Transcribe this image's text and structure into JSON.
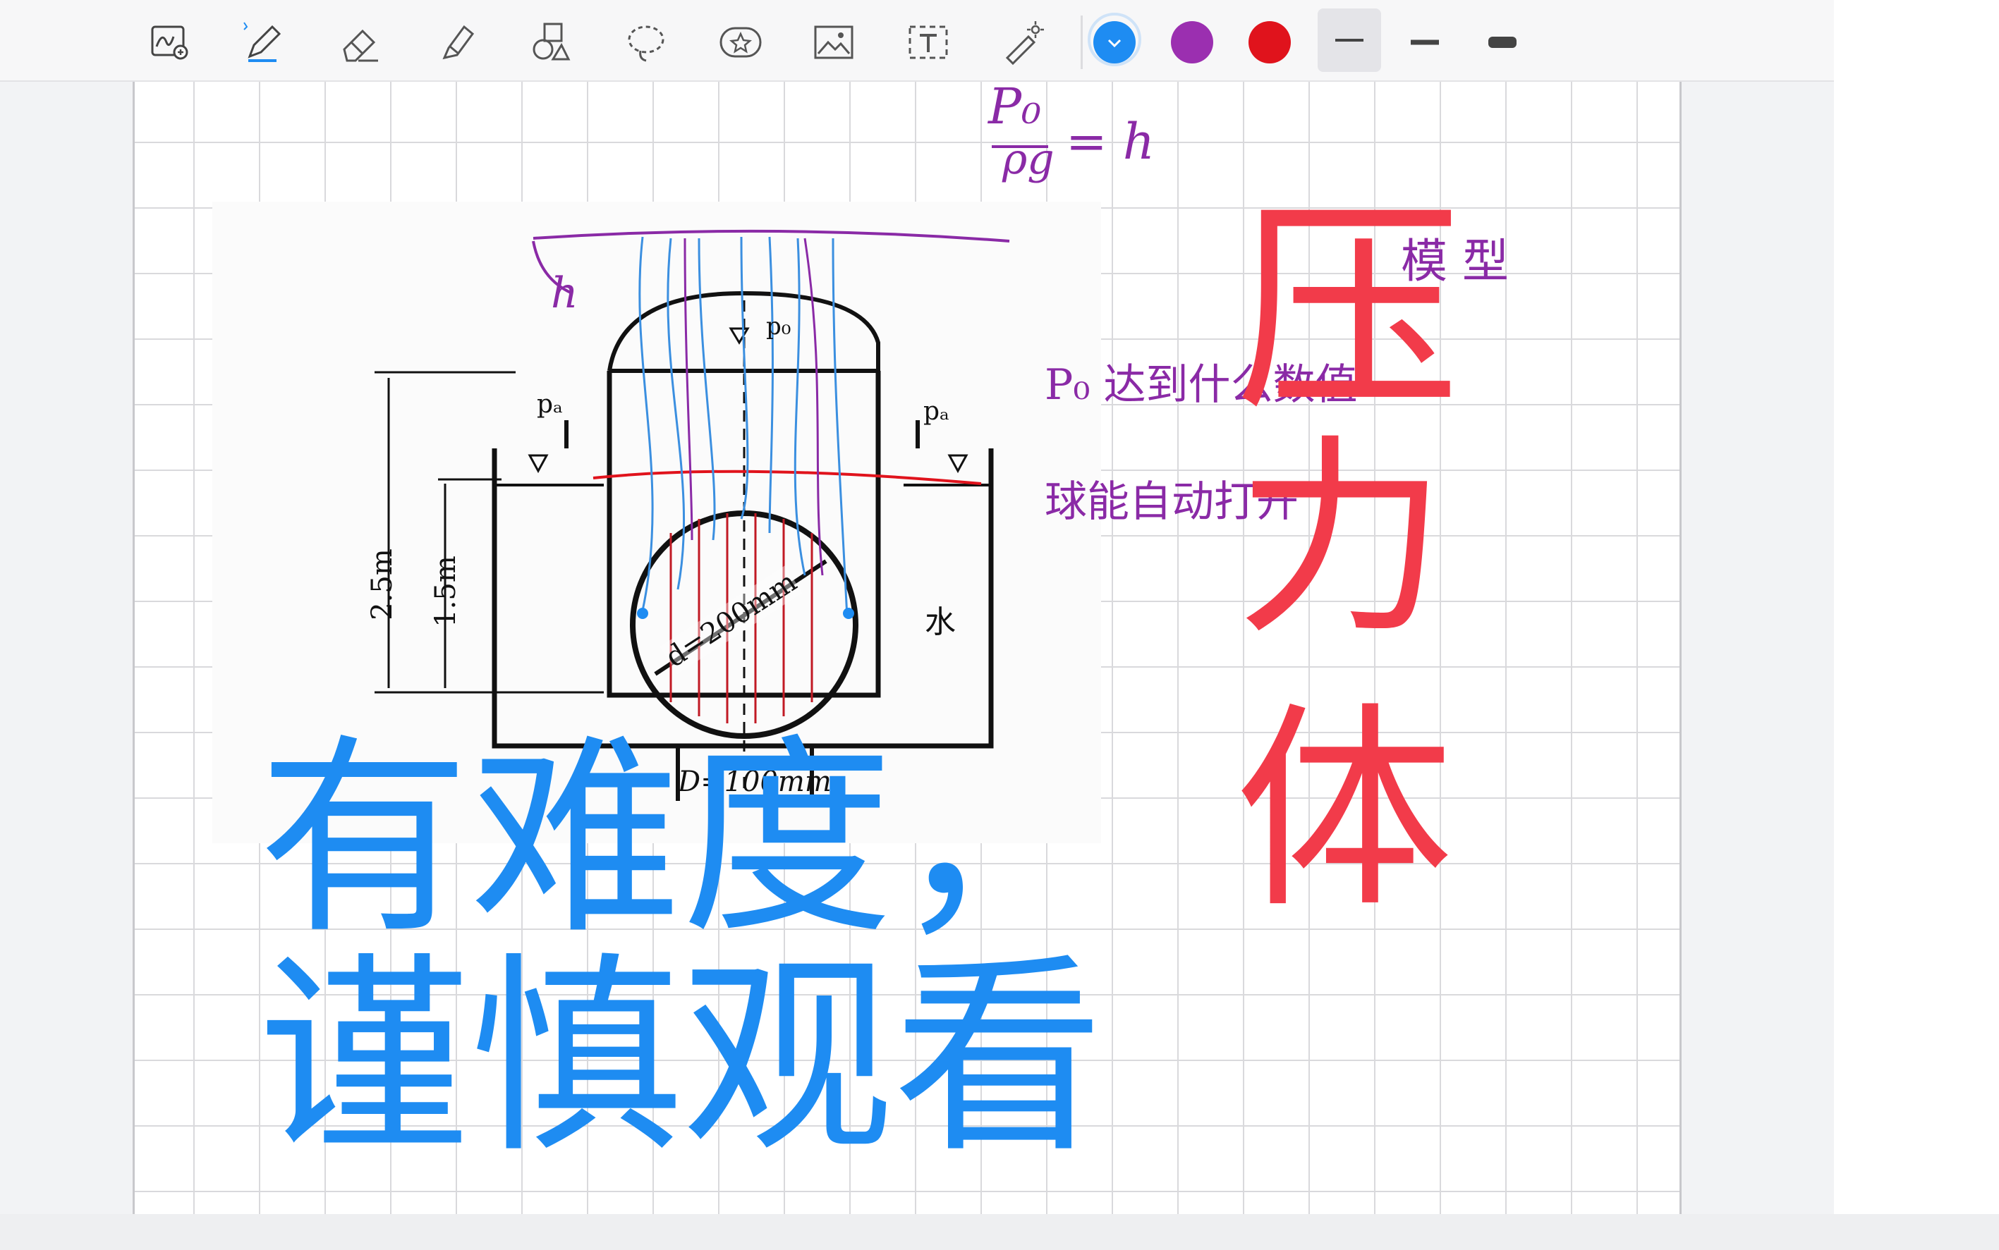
{
  "toolbar": {
    "tools": [
      {
        "name": "zoom-in-tool",
        "icon": "handwriting-zoom-icon"
      },
      {
        "name": "pen-tool",
        "icon": "pen-icon"
      },
      {
        "name": "eraser-tool",
        "icon": "eraser-icon"
      },
      {
        "name": "highlighter-tool",
        "icon": "highlighter-icon"
      },
      {
        "name": "shapes-tool",
        "icon": "shapes-icon"
      },
      {
        "name": "lasso-tool",
        "icon": "lasso-icon"
      },
      {
        "name": "sticker-tool",
        "icon": "star-sticker-icon"
      },
      {
        "name": "image-tool",
        "icon": "image-icon"
      },
      {
        "name": "text-tool",
        "icon": "text-icon"
      },
      {
        "name": "laser-pointer-tool",
        "icon": "laser-pointer-icon"
      }
    ],
    "colors": [
      "#1e8cf2",
      "#9b2fb0",
      "#e0131c"
    ],
    "stroke_widths": [
      "thin",
      "medium",
      "thick"
    ]
  },
  "canvas": {
    "title_blue_line1": "有难度，",
    "title_blue_line2": "谨慎观看",
    "title_red": [
      "压",
      "力",
      "体"
    ],
    "handwritten": {
      "formula_left": "P₀",
      "formula_denominator": "ρg",
      "formula_right": "= h",
      "h_label": "h",
      "model": "模 型",
      "note_line1": "P₀ 达到什么数值",
      "note_line2": "球能自动打开"
    },
    "diagram": {
      "label_p0_top": "p₀",
      "label_pa_left": "pₐ",
      "label_pa_right": "pₐ",
      "dim_25": "2.5m",
      "dim_15": "1.5m",
      "sphere_d": "d=200mm",
      "water": "水",
      "bottom_D": "D=100mm"
    }
  }
}
